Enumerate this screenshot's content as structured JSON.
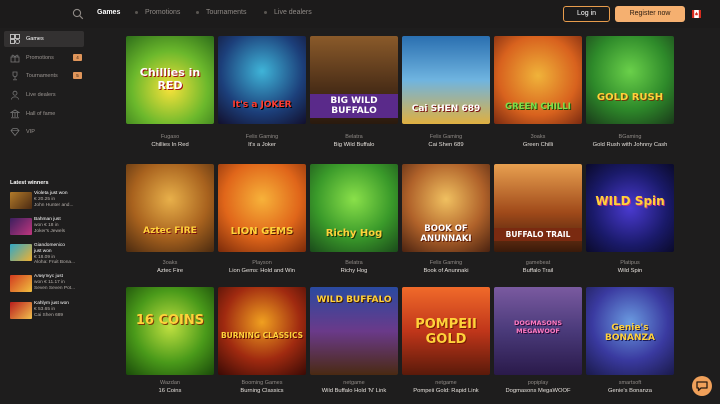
{
  "header": {
    "nav": [
      "Games",
      "Promotions",
      "Tournaments",
      "Live dealers"
    ],
    "login_label": "Log in",
    "register_label": "Register now"
  },
  "sidebar": {
    "items": [
      {
        "label": "Games",
        "icon": "games-icon"
      },
      {
        "label": "Promotions",
        "icon": "gift-icon",
        "badge": "4"
      },
      {
        "label": "Tournaments",
        "icon": "trophy-icon",
        "badge": "5"
      },
      {
        "label": "Live dealers",
        "icon": "dealer-icon"
      },
      {
        "label": "Hall of fame",
        "icon": "hall-icon"
      },
      {
        "label": "VIP",
        "icon": "diamond-icon"
      }
    ],
    "latest_title": "Latest winners",
    "winners": [
      {
        "l1": "Violeta just won",
        "l2": "€ 20.25 in",
        "l3": "John Hunter and..."
      },
      {
        "l1": "Bahman just",
        "l2": "won € 18 in",
        "l3": "Joker's Jewels"
      },
      {
        "l1": "Giandomenico",
        "l2": "just won",
        "l3": "€ 18.09 in",
        "l4": "Aloha: Fruit Bona..."
      },
      {
        "l1": "Алиуткус just",
        "l2": "won € 11.17 in",
        "l3": "Seven Seven Pot..."
      },
      {
        "l1": "Kahlym just won",
        "l2": "€ 53.65 in",
        "l3": "Cai Shen 689"
      }
    ]
  },
  "games": [
    {
      "provider": "Fugaso",
      "name": "Chillies In Red",
      "art_title": "Chillies in RED"
    },
    {
      "provider": "Felix Gaming",
      "name": "It's a Joker",
      "art_title": "It's a JOKER"
    },
    {
      "provider": "Belatra",
      "name": "Big Wild Buffalo",
      "art_title": "BIG WILD BUFFALO"
    },
    {
      "provider": "Felix Gaming",
      "name": "Cai Shen 689",
      "art_title": "Cai SHEN 689"
    },
    {
      "provider": "3oaks",
      "name": "Green Chilli",
      "art_title": "GREEN CHILLI"
    },
    {
      "provider": "BGaming",
      "name": "Gold Rush with Johnny Cash",
      "art_title": "GOLD RUSH"
    },
    {
      "provider": "3oaks",
      "name": "Aztec Fire",
      "art_title": "Aztec FIRE"
    },
    {
      "provider": "Playson",
      "name": "Lion Gems: Hold and Win",
      "art_title": "LION GEMS"
    },
    {
      "provider": "Belatra",
      "name": "Richy Hog",
      "art_title": "Richy Hog"
    },
    {
      "provider": "Felix Gaming",
      "name": "Book of Anunnaki",
      "art_title": "BOOK OF ANUNNAKI"
    },
    {
      "provider": "gamebeat",
      "name": "Buffalo Trail",
      "art_title": "BUFFALO TRAIL"
    },
    {
      "provider": "Platipus",
      "name": "Wild Spin",
      "art_title": "WILD Spin"
    },
    {
      "provider": "Wazdan",
      "name": "16 Coins",
      "art_title": "16 COINS"
    },
    {
      "provider": "Booming Games",
      "name": "Burning Classics",
      "art_title": "BURNING CLASSICS"
    },
    {
      "provider": "netgame",
      "name": "Wild Buffalo Hold 'N' Link",
      "art_title": "WILD BUFFALO"
    },
    {
      "provider": "netgame",
      "name": "Pompeii Gold: Rapid Link",
      "art_title": "POMPEII GOLD"
    },
    {
      "provider": "popiplay",
      "name": "Dogmasons MegaWOOF",
      "art_title": "DOGMASONS MEGAWOOF"
    },
    {
      "provider": "smartsoft",
      "name": "Genie's Bonanza",
      "art_title": "Genie's BONANZA"
    }
  ],
  "colors": {
    "accent": "#f5b070",
    "background": "#1e1d1d"
  }
}
